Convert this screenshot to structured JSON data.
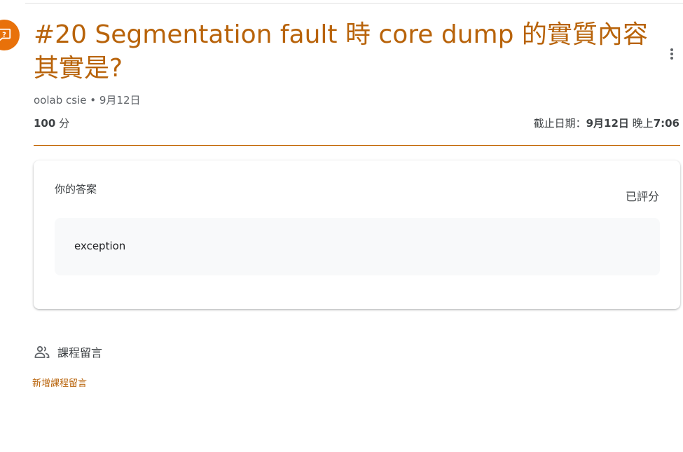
{
  "assignment": {
    "type_icon": "question-icon",
    "title": "#20 Segmentation fault 時 core dump 的實質內容其實是?",
    "author": "oolab csie",
    "date": "9月12日",
    "points_value": "100",
    "points_unit": "分",
    "due_label": "截止日期：",
    "due_date": "9月12日",
    "due_time_label": "晚上",
    "due_time": "7:06",
    "accent_color": "#b8630a"
  },
  "answer_card": {
    "title": "你的答案",
    "status": "已評分",
    "answer": "exception"
  },
  "comments": {
    "title": "課程留言",
    "icon": "people-icon",
    "add_label": "新增課程留言"
  }
}
